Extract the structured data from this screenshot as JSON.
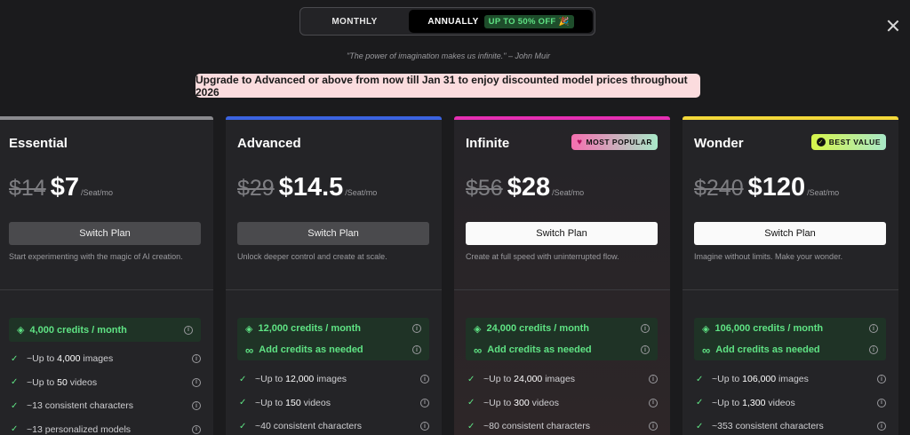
{
  "toggle": {
    "monthly": "MONTHLY",
    "annually": "ANNUALLY",
    "discount_badge": "UP TO 50% OFF 🎉"
  },
  "quote": "\"The power of imagination makes us infinite.\" – John Muir",
  "banner": "Upgrade to Advanced or above from now till Jan 31 to enjoy discounted model prices throughout 2026",
  "colors": {
    "essential": "#8a8a8e",
    "advanced": "#3b63e0",
    "infinite": "#e62fb3",
    "wonder": "#f3d83a",
    "accent_green": "#5fe384"
  },
  "plans": [
    {
      "name": "Essential",
      "old_price": "$14",
      "price": "$7",
      "unit": "/Seat/mo",
      "button": "Switch Plan",
      "desc": "Start experimenting with the magic of AI creation.",
      "credits": "4,000 credits / month",
      "features": [
        {
          "pre": "~Up to ",
          "num": "4,000",
          "post": " images"
        },
        {
          "pre": "~Up to ",
          "num": "50",
          "post": " videos"
        },
        {
          "pre": "~13",
          "num": "",
          "post": " consistent characters"
        },
        {
          "pre": "~13",
          "num": "",
          "post": " personalized models"
        }
      ]
    },
    {
      "name": "Advanced",
      "old_price": "$29",
      "price": "$14.5",
      "unit": "/Seat/mo",
      "button": "Switch Plan",
      "desc": "Unlock deeper control and create at scale.",
      "credits": "12,000 credits / month",
      "extra": "Add credits as needed",
      "features": [
        {
          "pre": "~Up to ",
          "num": "12,000",
          "post": " images"
        },
        {
          "pre": "~Up to ",
          "num": "150",
          "post": " videos"
        },
        {
          "pre": "~40",
          "num": "",
          "post": " consistent characters"
        }
      ]
    },
    {
      "name": "Infinite",
      "tag": "MOST POPULAR",
      "old_price": "$56",
      "price": "$28",
      "unit": "/Seat/mo",
      "button": "Switch Plan",
      "desc": "Create at full speed with uninterrupted flow.",
      "credits": "24,000 credits / month",
      "extra": "Add credits as needed",
      "features": [
        {
          "pre": "~Up to ",
          "num": "24,000",
          "post": " images"
        },
        {
          "pre": "~Up to ",
          "num": "300",
          "post": " videos"
        },
        {
          "pre": "~80",
          "num": "",
          "post": " consistent characters"
        }
      ]
    },
    {
      "name": "Wonder",
      "tag": "BEST VALUE",
      "old_price": "$240",
      "price": "$120",
      "unit": "/Seat/mo",
      "button": "Switch Plan",
      "desc": "Imagine without limits. Make your wonder.",
      "credits": "106,000 credits / month",
      "extra": "Add credits as needed",
      "features": [
        {
          "pre": "~Up to ",
          "num": "106,000",
          "post": " images"
        },
        {
          "pre": "~Up to ",
          "num": "1,300",
          "post": " videos"
        },
        {
          "pre": "~353",
          "num": "",
          "post": " consistent characters"
        }
      ]
    }
  ]
}
